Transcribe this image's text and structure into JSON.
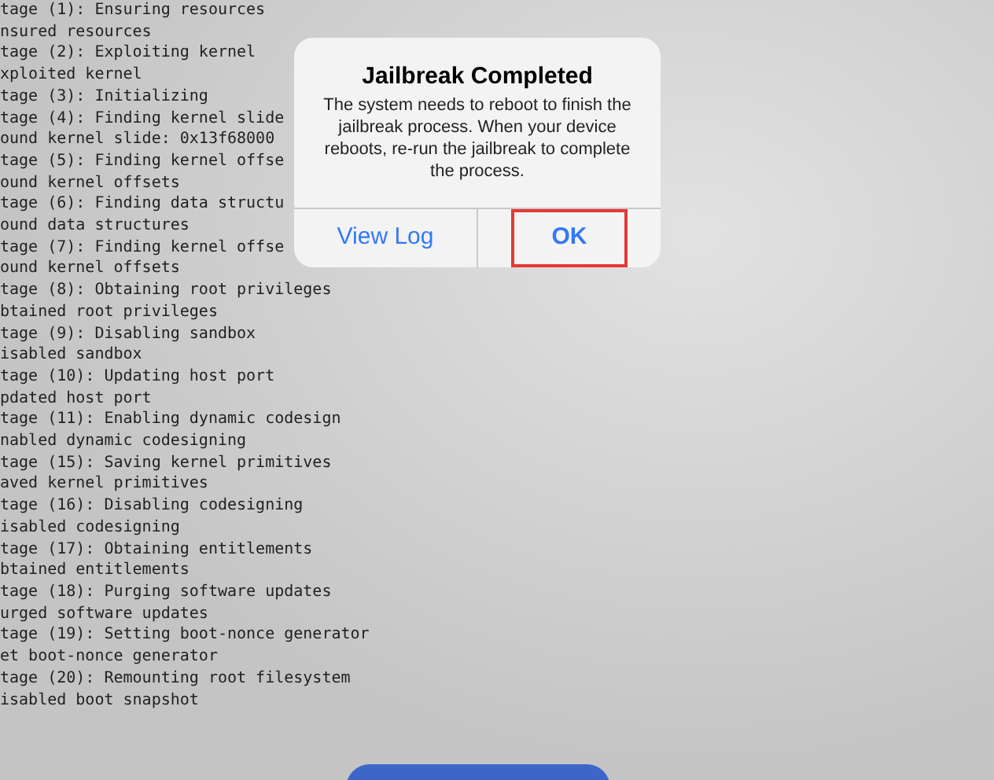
{
  "log_lines": [
    "tage (1): Ensuring resources",
    "nsured resources",
    "tage (2): Exploiting kernel",
    "xploited kernel",
    "tage (3): Initializing",
    "tage (4): Finding kernel slide",
    "ound kernel slide: 0x13f68000",
    "tage (5): Finding kernel offse",
    "ound kernel offsets",
    "tage (6): Finding data structu",
    "ound data structures",
    "tage (7): Finding kernel offse",
    "ound kernel offsets",
    "tage (8): Obtaining root privileges",
    "btained root privileges",
    "tage (9): Disabling sandbox",
    "isabled sandbox",
    "tage (10): Updating host port",
    "pdated host port",
    "tage (11): Enabling dynamic codesign",
    "nabled dynamic codesigning",
    "tage (15): Saving kernel primitives",
    "aved kernel primitives",
    "tage (16): Disabling codesigning",
    "isabled codesigning",
    "tage (17): Obtaining entitlements",
    "btained entitlements",
    "tage (18): Purging software updates",
    "urged software updates",
    "tage (19): Setting boot-nonce generator",
    "et boot-nonce generator",
    "tage (20): Remounting root filesystem",
    "isabled boot snapshot"
  ],
  "alert": {
    "title": "Jailbreak Completed",
    "message": "The system needs to reboot to finish the jailbreak process. When your device reboots, re-run the jailbreak to complete the process.",
    "buttons": [
      {
        "label": "View Log",
        "highlighted": false
      },
      {
        "label": "OK",
        "highlighted": true
      }
    ]
  }
}
